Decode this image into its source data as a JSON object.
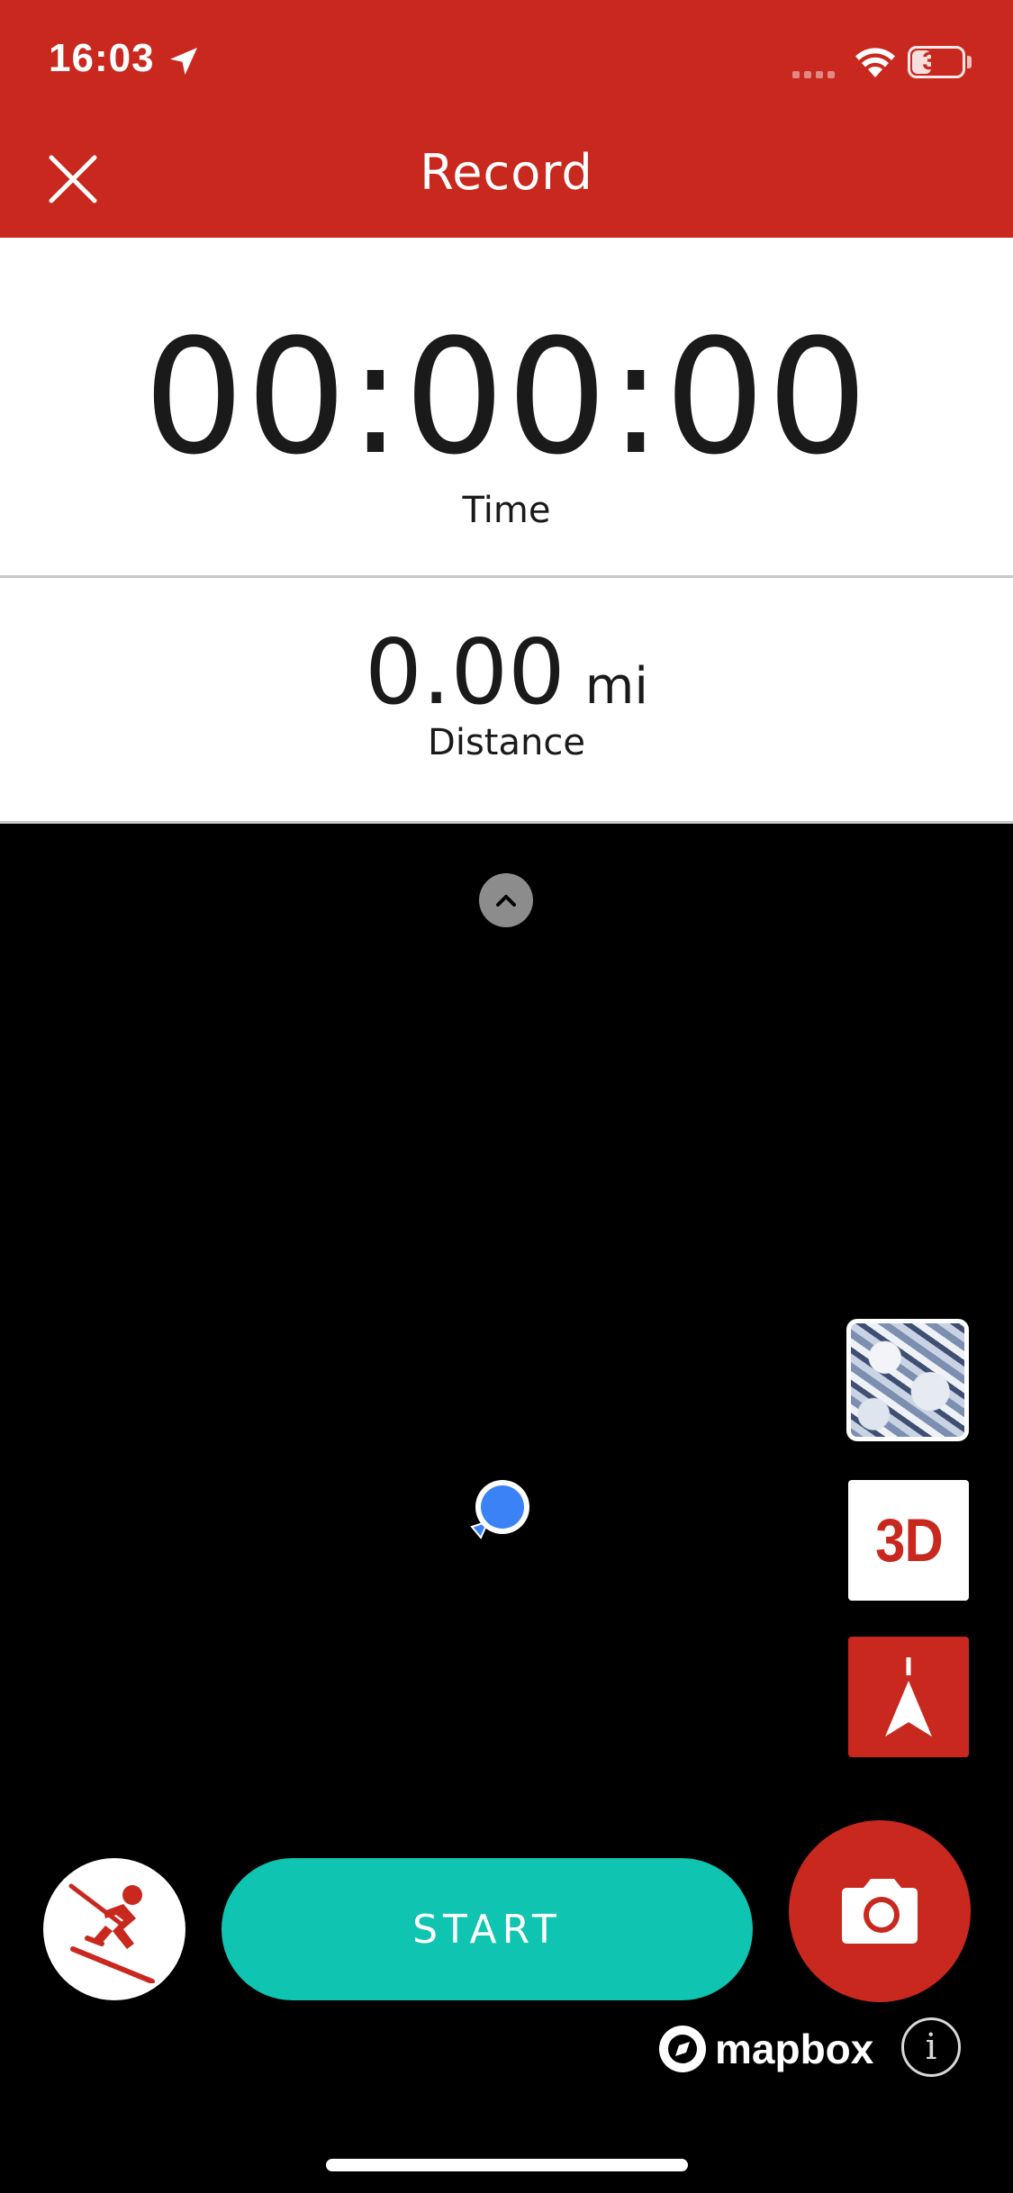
{
  "status_bar": {
    "time": "16:03",
    "battery_level": "39",
    "battery_fraction": 0.39,
    "icons": [
      "location-arrow-icon",
      "signal-icon",
      "wifi-icon",
      "battery-icon"
    ]
  },
  "header": {
    "title": "Record",
    "close_icon": "close-icon",
    "background_color": "#c8281e"
  },
  "stats": {
    "time_value": "00:00:00",
    "time_label": "Time",
    "distance_value": "0.00",
    "distance_unit": "mi",
    "distance_label": "Distance"
  },
  "map": {
    "expand_icon": "chevron-up-icon",
    "terrain_layer_icon": "terrain-layer-icon",
    "three_d_label": "3D",
    "compass_icon": "north-arrow-icon",
    "user_location_icon": "user-location-icon",
    "attribution": "mapbox",
    "info_label": "i"
  },
  "controls": {
    "activity_icon": "skier-icon",
    "start_label": "START",
    "camera_icon": "camera-icon"
  },
  "colors": {
    "brand_red": "#c8281e",
    "start_teal": "#0fc4b1",
    "location_blue": "#3b82f6"
  }
}
